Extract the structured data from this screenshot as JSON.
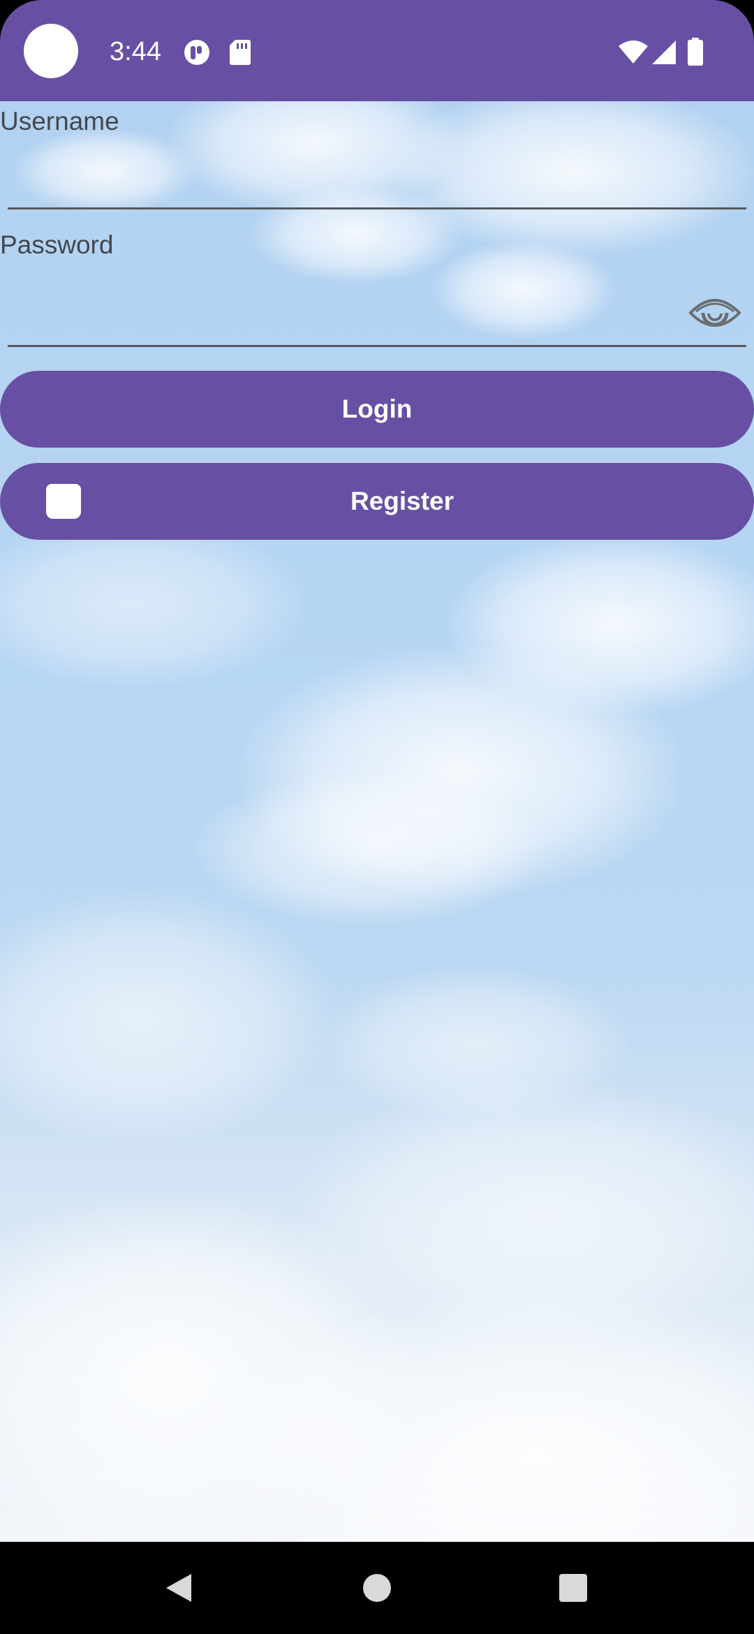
{
  "status_bar": {
    "time": "3:44",
    "icons": [
      "camera-dot",
      "app-notification-icon",
      "sd-card-icon",
      "wifi-icon",
      "signal-icon",
      "battery-icon"
    ],
    "background": "#6750A4"
  },
  "login_form": {
    "username": {
      "label": "Username",
      "value": ""
    },
    "password": {
      "label": "Password",
      "value": "",
      "visibility_icon": "eye-icon"
    },
    "login_button": {
      "label": "Login"
    },
    "register_button": {
      "label": "Register",
      "icon": "register-icon"
    }
  },
  "navigation_bar": {
    "buttons": [
      "back-icon",
      "home-icon",
      "recents-icon"
    ]
  },
  "colors": {
    "primary": "#6750A4",
    "on_primary": "#FFFFFF",
    "label_text": "#44474F"
  }
}
